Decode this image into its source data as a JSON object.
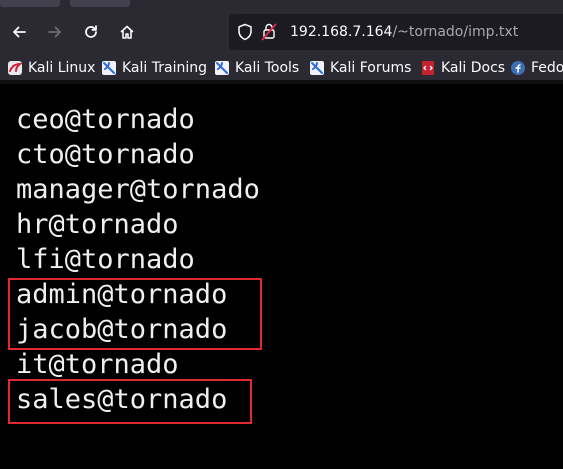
{
  "browser": {
    "url_host": "192.168.7.164",
    "url_path": "/~tornado/imp.txt"
  },
  "bookmarks": [
    {
      "label": "Kali Linux",
      "icon": "kali-linux-icon"
    },
    {
      "label": "Kali Training",
      "icon": "kali-dragon-icon"
    },
    {
      "label": "Kali Tools",
      "icon": "kali-dragon-icon"
    },
    {
      "label": "Kali Forums",
      "icon": "kali-dragon-icon"
    },
    {
      "label": "Kali Docs",
      "icon": "kali-docs-icon"
    },
    {
      "label": "Fedo",
      "icon": "fedora-icon"
    }
  ],
  "file": {
    "lines": [
      "ceo@tornado",
      "cto@tornado",
      "manager@tornado",
      "hr@tornado",
      "lfi@tornado",
      "admin@tornado",
      "jacob@tornado",
      "it@tornado",
      "sales@tornado"
    ]
  },
  "colors": {
    "highlight_box": "#e0282f",
    "content_background": "#000000",
    "text": "#f0f0f0",
    "toolbar": "#2b2a33"
  }
}
